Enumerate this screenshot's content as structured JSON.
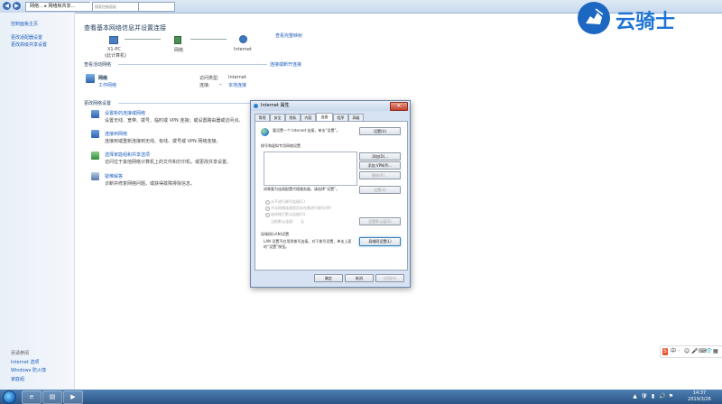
{
  "addressbar": {
    "crumbs": [
      "网络...",
      "网络和共享..."
    ],
    "search_placeholder": "搜索控制面板"
  },
  "sidebar": {
    "items": [
      "控制面板主页",
      "更改适配器设置",
      "更改高级共享设置"
    ],
    "see_also_title": "另请参阅",
    "see_also": [
      "Internet 选项",
      "Windows 防火墙",
      "家庭组"
    ]
  },
  "main": {
    "title": "查看基本网络信息并设置连接",
    "map_link": "查看完整映射",
    "nodes": [
      {
        "label": "X1-PC",
        "sub": "(此计算机)"
      },
      {
        "label": "网络",
        "sub": ""
      },
      {
        "label": "Internet",
        "sub": ""
      }
    ],
    "active_title": "查看活动网络",
    "connect_link": "连接或断开连接",
    "network_name": "网络",
    "network_type": "工作网络",
    "access_label": "访问类型:",
    "access_value": "Internet",
    "conn_label": "连接:",
    "conn_value": "本地连接",
    "change_title": "更改网络设置",
    "tasks": [
      {
        "title": "设置新的连接或网络",
        "desc": "设置无线、宽带、拨号、临时或 VPN 连接；或设置路由器或访问点。"
      },
      {
        "title": "连接到网络",
        "desc": "连接到或重新连接到无线、有线、拨号或 VPN 网络连接。"
      },
      {
        "title": "选择家庭组和共享选项",
        "desc": "访问位于其他网络计算机上的文件和打印机，或更改共享设置。"
      },
      {
        "title": "疑难解答",
        "desc": "诊断并修复网络问题，或获得故障排除信息。"
      }
    ]
  },
  "dialog": {
    "title": "Internet 属性",
    "close": "✕",
    "tabs": [
      "常规",
      "安全",
      "隐私",
      "内容",
      "连接",
      "程序",
      "高级"
    ],
    "active_tab": "连接",
    "setup_text": "要设置一个 Internet 连接，单击“设置”。",
    "setup_btn": "设置(U)",
    "dialup_title": "拨号和虚拟专用网络设置",
    "add_btn": "添加(D)...",
    "add_vpn_btn": "添加 VPN(P)...",
    "remove_btn": "删除(R)...",
    "settings_hint": "如果要为连接配置代理服务器，请选择“设置”。",
    "settings_btn": "设置(S)",
    "radio_options": [
      "从不进行拨号连接(C)",
      "不论网络连接是否存在都进行拨号(W)",
      "始终拨打默认连接(O)"
    ],
    "current_label": "当前默认连接:",
    "none_label": "无",
    "set_default_btn": "设置默认值(E)",
    "lan_title": "局域网(LAN)设置",
    "lan_text": "LAN 设置不应用到拨号连接。对于拨号设置，单击上面的“设置”按钮。",
    "lan_btn": "局域网设置(L)",
    "ok": "确定",
    "cancel": "取消",
    "apply": "应用(A)"
  },
  "watermark": {
    "text": "云骑士"
  },
  "ime": {
    "items": [
      "S",
      "中",
      "·",
      "☺",
      "🎤",
      "⌨",
      "👕",
      "▦"
    ]
  },
  "taskbar": {
    "clock_time": "14:37",
    "clock_date": "2019/3/26",
    "tray_icons": [
      "▲",
      "🛡",
      "▮",
      "🔊",
      "⚑"
    ]
  }
}
